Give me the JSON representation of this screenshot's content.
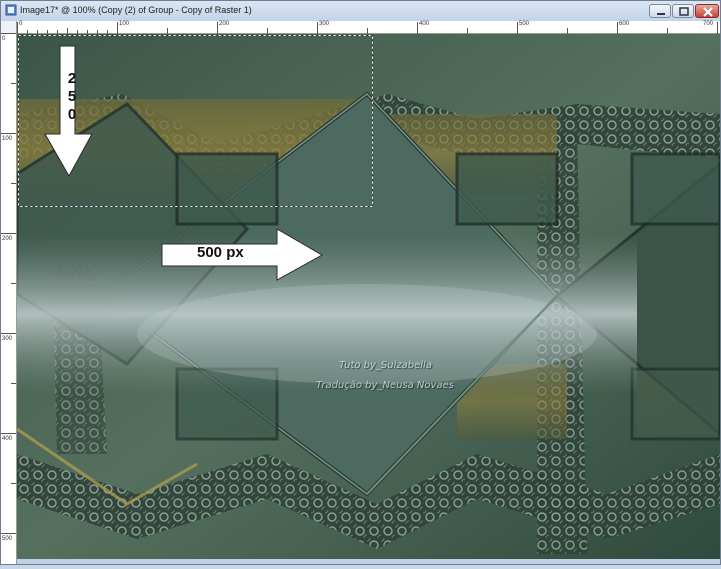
{
  "window": {
    "title": "Image17* @ 100% (Copy (2) of Group - Copy of Raster 1)"
  },
  "ruler": {
    "top_labels": [
      "0",
      "100",
      "200",
      "300",
      "400",
      "500",
      "600",
      "700"
    ],
    "left_labels": [
      "0",
      "100",
      "200",
      "300",
      "400",
      "500"
    ]
  },
  "annotations": {
    "vertical_label": "2\n5\n0",
    "horizontal_label": "500 px"
  },
  "watermark": {
    "line1": "Tuto by_Suizabella",
    "line2": "Tradução by_Neusa Novaes"
  },
  "icons": {
    "app": "paint-app-icon",
    "minimize": "minimize-icon",
    "maximize": "maximize-icon",
    "close": "close-icon"
  },
  "colors": {
    "accent_green": "#3e5a4c",
    "gold": "#8a7a3a",
    "pale": "#c6d6d8"
  }
}
